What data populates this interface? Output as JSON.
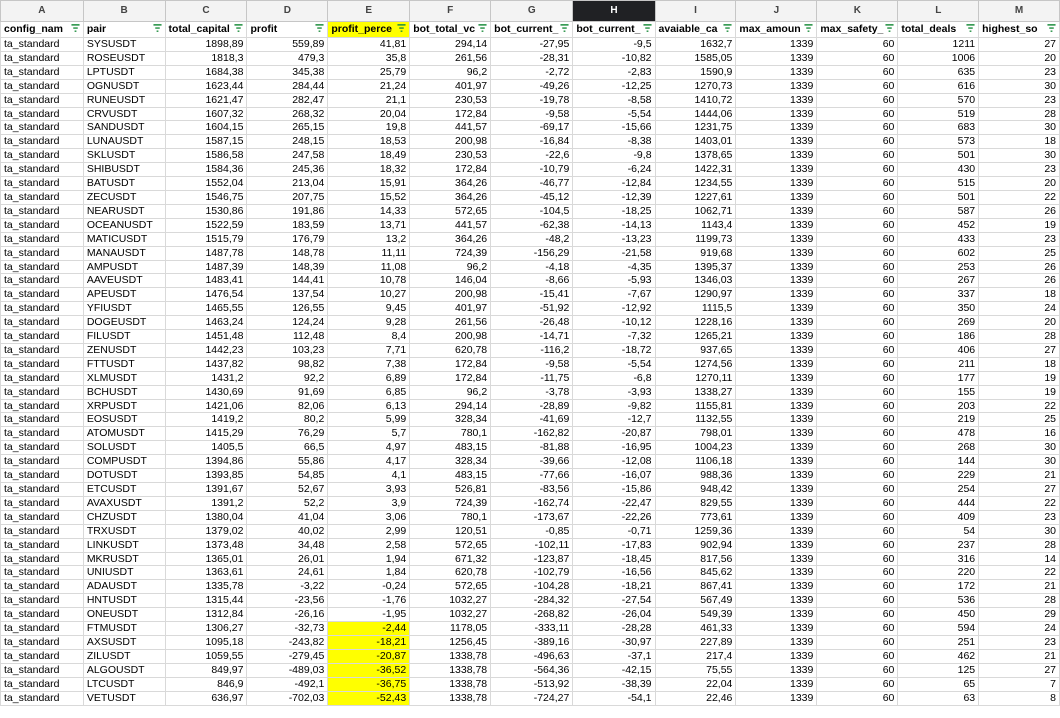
{
  "column_letters": [
    "A",
    "B",
    "C",
    "D",
    "E",
    "F",
    "G",
    "H",
    "I",
    "J",
    "K",
    "L",
    "M"
  ],
  "selected_column": "H",
  "headers": [
    "config_nam",
    "pair",
    "total_capital",
    "profit",
    "profit_perce",
    "bot_total_vc",
    "bot_current_",
    "bot_current_",
    "avaiable_ca",
    "max_amoun",
    "max_safety_",
    "total_deals",
    "highest_so"
  ],
  "highlighted_header": "profit_perce",
  "highlight_color": "#ffff00",
  "rows": [
    [
      "ta_standard",
      "SYSUSDT",
      "1898,89",
      "559,89",
      "41,81",
      "294,14",
      "-27,95",
      "-9,5",
      "1632,7",
      "1339",
      "60",
      "1211",
      "27"
    ],
    [
      "ta_standard",
      "ROSEUSDT",
      "1818,3",
      "479,3",
      "35,8",
      "261,56",
      "-28,31",
      "-10,82",
      "1585,05",
      "1339",
      "60",
      "1006",
      "20"
    ],
    [
      "ta_standard",
      "LPTUSDT",
      "1684,38",
      "345,38",
      "25,79",
      "96,2",
      "-2,72",
      "-2,83",
      "1590,9",
      "1339",
      "60",
      "635",
      "23"
    ],
    [
      "ta_standard",
      "OGNUSDT",
      "1623,44",
      "284,44",
      "21,24",
      "401,97",
      "-49,26",
      "-12,25",
      "1270,73",
      "1339",
      "60",
      "616",
      "30"
    ],
    [
      "ta_standard",
      "RUNEUSDT",
      "1621,47",
      "282,47",
      "21,1",
      "230,53",
      "-19,78",
      "-8,58",
      "1410,72",
      "1339",
      "60",
      "570",
      "23"
    ],
    [
      "ta_standard",
      "CRVUSDT",
      "1607,32",
      "268,32",
      "20,04",
      "172,84",
      "-9,58",
      "-5,54",
      "1444,06",
      "1339",
      "60",
      "519",
      "28"
    ],
    [
      "ta_standard",
      "SANDUSDT",
      "1604,15",
      "265,15",
      "19,8",
      "441,57",
      "-69,17",
      "-15,66",
      "1231,75",
      "1339",
      "60",
      "683",
      "30"
    ],
    [
      "ta_standard",
      "LUNAUSDT",
      "1587,15",
      "248,15",
      "18,53",
      "200,98",
      "-16,84",
      "-8,38",
      "1403,01",
      "1339",
      "60",
      "573",
      "18"
    ],
    [
      "ta_standard",
      "SKLUSDT",
      "1586,58",
      "247,58",
      "18,49",
      "230,53",
      "-22,6",
      "-9,8",
      "1378,65",
      "1339",
      "60",
      "501",
      "30"
    ],
    [
      "ta_standard",
      "SHIBUSDT",
      "1584,36",
      "245,36",
      "18,32",
      "172,84",
      "-10,79",
      "-6,24",
      "1422,31",
      "1339",
      "60",
      "430",
      "23"
    ],
    [
      "ta_standard",
      "BATUSDT",
      "1552,04",
      "213,04",
      "15,91",
      "364,26",
      "-46,77",
      "-12,84",
      "1234,55",
      "1339",
      "60",
      "515",
      "20"
    ],
    [
      "ta_standard",
      "ZECUSDT",
      "1546,75",
      "207,75",
      "15,52",
      "364,26",
      "-45,12",
      "-12,39",
      "1227,61",
      "1339",
      "60",
      "501",
      "22"
    ],
    [
      "ta_standard",
      "NEARUSDT",
      "1530,86",
      "191,86",
      "14,33",
      "572,65",
      "-104,5",
      "-18,25",
      "1062,71",
      "1339",
      "60",
      "587",
      "26"
    ],
    [
      "ta_standard",
      "OCEANUSDT",
      "1522,59",
      "183,59",
      "13,71",
      "441,57",
      "-62,38",
      "-14,13",
      "1143,4",
      "1339",
      "60",
      "452",
      "19"
    ],
    [
      "ta_standard",
      "MATICUSDT",
      "1515,79",
      "176,79",
      "13,2",
      "364,26",
      "-48,2",
      "-13,23",
      "1199,73",
      "1339",
      "60",
      "433",
      "23"
    ],
    [
      "ta_standard",
      "MANAUSDT",
      "1487,78",
      "148,78",
      "11,11",
      "724,39",
      "-156,29",
      "-21,58",
      "919,68",
      "1339",
      "60",
      "602",
      "25"
    ],
    [
      "ta_standard",
      "AMPUSDT",
      "1487,39",
      "148,39",
      "11,08",
      "96,2",
      "-4,18",
      "-4,35",
      "1395,37",
      "1339",
      "60",
      "253",
      "26"
    ],
    [
      "ta_standard",
      "AAVEUSDT",
      "1483,41",
      "144,41",
      "10,78",
      "146,04",
      "-8,66",
      "-5,93",
      "1346,03",
      "1339",
      "60",
      "267",
      "26"
    ],
    [
      "ta_standard",
      "APEUSDT",
      "1476,54",
      "137,54",
      "10,27",
      "200,98",
      "-15,41",
      "-7,67",
      "1290,97",
      "1339",
      "60",
      "337",
      "18"
    ],
    [
      "ta_standard",
      "YFIUSDT",
      "1465,55",
      "126,55",
      "9,45",
      "401,97",
      "-51,92",
      "-12,92",
      "1115,5",
      "1339",
      "60",
      "350",
      "24"
    ],
    [
      "ta_standard",
      "DOGEUSDT",
      "1463,24",
      "124,24",
      "9,28",
      "261,56",
      "-26,48",
      "-10,12",
      "1228,16",
      "1339",
      "60",
      "269",
      "20"
    ],
    [
      "ta_standard",
      "FILUSDT",
      "1451,48",
      "112,48",
      "8,4",
      "200,98",
      "-14,71",
      "-7,32",
      "1265,21",
      "1339",
      "60",
      "186",
      "28"
    ],
    [
      "ta_standard",
      "ZENUSDT",
      "1442,23",
      "103,23",
      "7,71",
      "620,78",
      "-116,2",
      "-18,72",
      "937,65",
      "1339",
      "60",
      "406",
      "27"
    ],
    [
      "ta_standard",
      "FTTUSDT",
      "1437,82",
      "98,82",
      "7,38",
      "172,84",
      "-9,58",
      "-5,54",
      "1274,56",
      "1339",
      "60",
      "211",
      "18"
    ],
    [
      "ta_standard",
      "XLMUSDT",
      "1431,2",
      "92,2",
      "6,89",
      "172,84",
      "-11,75",
      "-6,8",
      "1270,11",
      "1339",
      "60",
      "177",
      "19"
    ],
    [
      "ta_standard",
      "BCHUSDT",
      "1430,69",
      "91,69",
      "6,85",
      "96,2",
      "-3,78",
      "-3,93",
      "1338,27",
      "1339",
      "60",
      "155",
      "19"
    ],
    [
      "ta_standard",
      "XRPUSDT",
      "1421,06",
      "82,06",
      "6,13",
      "294,14",
      "-28,89",
      "-9,82",
      "1155,81",
      "1339",
      "60",
      "203",
      "22"
    ],
    [
      "ta_standard",
      "EOSUSDT",
      "1419,2",
      "80,2",
      "5,99",
      "328,34",
      "-41,69",
      "-12,7",
      "1132,55",
      "1339",
      "60",
      "219",
      "25"
    ],
    [
      "ta_standard",
      "ATOMUSDT",
      "1415,29",
      "76,29",
      "5,7",
      "780,1",
      "-162,82",
      "-20,87",
      "798,01",
      "1339",
      "60",
      "478",
      "16"
    ],
    [
      "ta_standard",
      "SOLUSDT",
      "1405,5",
      "66,5",
      "4,97",
      "483,15",
      "-81,88",
      "-16,95",
      "1004,23",
      "1339",
      "60",
      "268",
      "30"
    ],
    [
      "ta_standard",
      "COMPUSDT",
      "1394,86",
      "55,86",
      "4,17",
      "328,34",
      "-39,66",
      "-12,08",
      "1106,18",
      "1339",
      "60",
      "144",
      "30"
    ],
    [
      "ta_standard",
      "DOTUSDT",
      "1393,85",
      "54,85",
      "4,1",
      "483,15",
      "-77,66",
      "-16,07",
      "988,36",
      "1339",
      "60",
      "229",
      "21"
    ],
    [
      "ta_standard",
      "ETCUSDT",
      "1391,67",
      "52,67",
      "3,93",
      "526,81",
      "-83,56",
      "-15,86",
      "948,42",
      "1339",
      "60",
      "254",
      "27"
    ],
    [
      "ta_standard",
      "AVAXUSDT",
      "1391,2",
      "52,2",
      "3,9",
      "724,39",
      "-162,74",
      "-22,47",
      "829,55",
      "1339",
      "60",
      "444",
      "22"
    ],
    [
      "ta_standard",
      "CHZUSDT",
      "1380,04",
      "41,04",
      "3,06",
      "780,1",
      "-173,67",
      "-22,26",
      "773,61",
      "1339",
      "60",
      "409",
      "23"
    ],
    [
      "ta_standard",
      "TRXUSDT",
      "1379,02",
      "40,02",
      "2,99",
      "120,51",
      "-0,85",
      "-0,71",
      "1259,36",
      "1339",
      "60",
      "54",
      "30"
    ],
    [
      "ta_standard",
      "LINKUSDT",
      "1373,48",
      "34,48",
      "2,58",
      "572,65",
      "-102,11",
      "-17,83",
      "902,94",
      "1339",
      "60",
      "237",
      "28"
    ],
    [
      "ta_standard",
      "MKRUSDT",
      "1365,01",
      "26,01",
      "1,94",
      "671,32",
      "-123,87",
      "-18,45",
      "817,56",
      "1339",
      "60",
      "316",
      "14"
    ],
    [
      "ta_standard",
      "UNIUSDT",
      "1363,61",
      "24,61",
      "1,84",
      "620,78",
      "-102,79",
      "-16,56",
      "845,62",
      "1339",
      "60",
      "220",
      "22"
    ],
    [
      "ta_standard",
      "ADAUSDT",
      "1335,78",
      "-3,22",
      "-0,24",
      "572,65",
      "-104,28",
      "-18,21",
      "867,41",
      "1339",
      "60",
      "172",
      "21"
    ],
    [
      "ta_standard",
      "HNTUSDT",
      "1315,44",
      "-23,56",
      "-1,76",
      "1032,27",
      "-284,32",
      "-27,54",
      "567,49",
      "1339",
      "60",
      "536",
      "28"
    ],
    [
      "ta_standard",
      "ONEUSDT",
      "1312,84",
      "-26,16",
      "-1,95",
      "1032,27",
      "-268,82",
      "-26,04",
      "549,39",
      "1339",
      "60",
      "450",
      "29"
    ],
    [
      "ta_standard",
      "FTMUSDT",
      "1306,27",
      "-32,73",
      "-2,44",
      "1178,05",
      "-333,11",
      "-28,28",
      "461,33",
      "1339",
      "60",
      "594",
      "24"
    ],
    [
      "ta_standard",
      "AXSUSDT",
      "1095,18",
      "-243,82",
      "-18,21",
      "1256,45",
      "-389,16",
      "-30,97",
      "227,89",
      "1339",
      "60",
      "251",
      "23"
    ],
    [
      "ta_standard",
      "ZILUSDT",
      "1059,55",
      "-279,45",
      "-20,87",
      "1338,78",
      "-496,63",
      "-37,1",
      "217,4",
      "1339",
      "60",
      "462",
      "21"
    ],
    [
      "ta_standard",
      "ALGOUSDT",
      "849,97",
      "-489,03",
      "-36,52",
      "1338,78",
      "-564,36",
      "-42,15",
      "75,55",
      "1339",
      "60",
      "125",
      "27"
    ],
    [
      "ta_standard",
      "LTCUSDT",
      "846,9",
      "-492,1",
      "-36,75",
      "1338,78",
      "-513,92",
      "-38,39",
      "22,04",
      "1339",
      "60",
      "65",
      "7"
    ],
    [
      "ta_standard",
      "VETUSDT",
      "636,97",
      "-702,03",
      "-52,43",
      "1338,78",
      "-724,27",
      "-54,1",
      "22,46",
      "1339",
      "60",
      "63",
      "8"
    ]
  ],
  "highlighted_cells_column_E_rows": [
    42,
    43,
    44,
    45,
    46,
    47
  ]
}
